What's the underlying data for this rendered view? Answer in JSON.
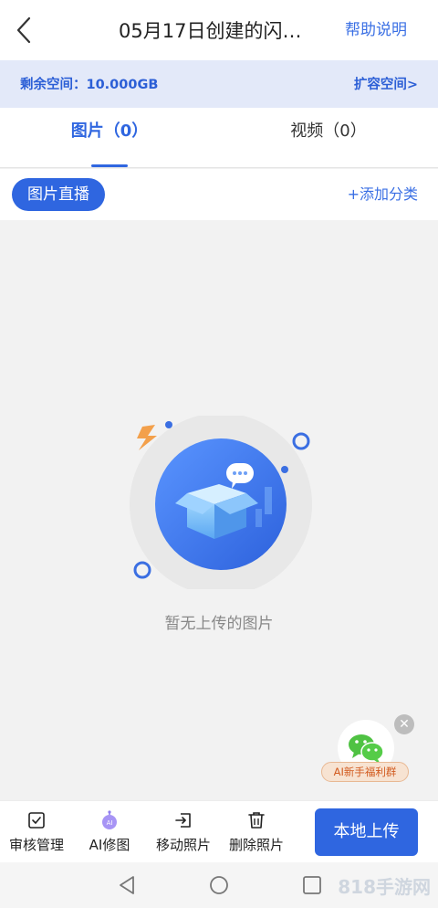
{
  "header": {
    "back_icon": "chevron-left-icon",
    "title": "05月17日创建的闪…",
    "help_label": "帮助说明"
  },
  "storage": {
    "remaining_label": "剩余空间：10.000GB",
    "expand_label": "扩容空间>"
  },
  "tabs": [
    {
      "label": "图片（0）",
      "active": true
    },
    {
      "label": "视频（0）",
      "active": false
    }
  ],
  "category_bar": {
    "active_chip": "图片直播",
    "add_label": "+添加分类"
  },
  "empty_state": {
    "message": "暂无上传的图片",
    "illustration_icon": "empty-box-icon"
  },
  "promo": {
    "label": "AI新手福利群",
    "icon": "wechat-icon",
    "close_icon": "close-icon"
  },
  "toolbar": {
    "items": [
      {
        "label": "审核管理",
        "icon": "checkbox-icon"
      },
      {
        "label": "AI修图",
        "icon": "ai-robot-icon"
      },
      {
        "label": "移动照片",
        "icon": "move-icon"
      },
      {
        "label": "删除照片",
        "icon": "trash-icon"
      }
    ],
    "upload_label": "本地上传"
  },
  "system_nav": {
    "back_icon": "triangle-back-icon",
    "home_icon": "circle-home-icon",
    "recents_icon": "square-recents-icon"
  },
  "watermark": "818手游网",
  "colors": {
    "accent": "#2f66e0",
    "storage_bg": "#e3e9f9",
    "page_bg": "#f2f2f2",
    "promo_text": "#d25a1e"
  }
}
